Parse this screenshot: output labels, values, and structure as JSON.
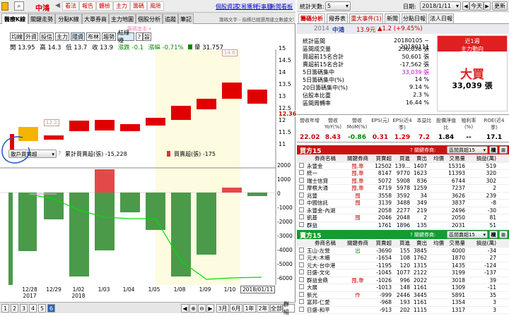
{
  "toolbar": {
    "stock": "中鴻",
    "btns": [
      "看法",
      "報告",
      "體檢",
      "主力",
      "籌碼",
      "風險"
    ],
    "right_links": [
      "個股資訊",
      "交易獲利",
      "行事曆",
      "新聞看板"
    ]
  },
  "chart_tabs": [
    "醫療K線",
    "關鍵走勢",
    "分點K線",
    "大單券商",
    "主力地圖",
    "個股分析",
    "追蹤",
    "筆記"
  ],
  "note": "籌碼文字 - 指標已經選用建立數據文字",
  "watermark": "籌碼查本→",
  "chip_tabs": [
    "均線",
    "外資",
    "投信",
    "主力",
    "隱資",
    "布林",
    "趨勢",
    "紅綠燈",
    "?",
    "設"
  ],
  "ohlc": {
    "open": "開 13.95",
    "high": "高 14.3",
    "low": "低 13.7",
    "close": "收 13.9",
    "chg_label": "漲跌",
    "chg": "-0.1",
    "pct_label": "漲幅",
    "pct": "-0.71%",
    "vol_label": "量",
    "vol": "31,757"
  },
  "price_axis": [
    "15",
    "14.5",
    "14",
    "13.5",
    "13",
    "12.5",
    "12",
    "11.5",
    "11"
  ],
  "price_cur": "12.36",
  "annot_high": "14.6",
  "annot_low": "12.2",
  "vol_select": "散戶買賣超",
  "vol_legend1": "累計買賣超(張) -15,228",
  "vol_legend2": "買賣超(張) -175",
  "vol_axis": [
    "2000",
    "1000",
    "0",
    "-1000",
    "-2000",
    "-3000",
    "-4000",
    "-5000",
    "-6000"
  ],
  "dates": [
    {
      "d": "12/28",
      "y": "2017"
    },
    {
      "d": "12/29",
      "y": ""
    },
    {
      "d": "1/02",
      "y": "2018"
    },
    {
      "d": "1/03",
      "y": ""
    },
    {
      "d": "1/04",
      "y": ""
    },
    {
      "d": "1/05",
      "y": ""
    },
    {
      "d": "1/08",
      "y": ""
    },
    {
      "d": "1/09",
      "y": ""
    },
    {
      "d": "1/10",
      "y": ""
    }
  ],
  "date_label": "2018/01/11",
  "pages": [
    "1",
    "2",
    "3",
    "4",
    "5",
    "6"
  ],
  "ranges": [
    "3月",
    "6月",
    "1年",
    "2年",
    "全部",
    "群組"
  ],
  "right": {
    "top": {
      "label": "統計天數:",
      "days": "5",
      "date_label": "日期:",
      "date": "2018/1/11",
      "today": "今天",
      "refresh": "更新"
    },
    "tabs": [
      "籌碼分析",
      "撥券表",
      "重大事件(1)",
      "新聞",
      "分點日報",
      "法人日報"
    ],
    "stock_line": {
      "year": "2014",
      "name": "中鴻",
      "price": "13.9元",
      "chg": "▲1.2 (+9.45%)"
    },
    "stats": [
      [
        "統計區間",
        "20180105 ~ 20180111"
      ],
      [
        "區間成交量",
        "236,036 張"
      ],
      [
        "買超前15名合計",
        "50,601 張"
      ],
      [
        "賣超前15名合計",
        "-17,562 張"
      ],
      [
        "5日籌碼集中",
        "33,039 張"
      ],
      [
        "5日籌碼集中(%)",
        "14 %"
      ],
      [
        "20日籌碼集中(%)",
        "9.14 %"
      ],
      [
        "佔股本比重",
        "2.3 %"
      ],
      [
        "區間周轉率",
        "16.44 %"
      ]
    ],
    "box": {
      "t1": "近1週",
      "t2": "主力動向",
      "big": "大買",
      "val": "33,039 張"
    },
    "fin_headers": [
      "營收年增",
      "營收YoY(%)",
      "營收MoM(%)",
      "EPS(元)",
      "EPS(近4季)",
      "本益比",
      "股價淨值比",
      "殖利率(%)",
      "ROE(近4季)"
    ],
    "fin_values": [
      "22.02",
      "8.43",
      "-0.86",
      "0.31",
      "1.29",
      "7.2",
      "1.84",
      "--",
      "17.1"
    ],
    "buy": {
      "title": "買方15",
      "hint": "?  關鍵券商:",
      "select": "區間買超15",
      "hdr": [
        "券商名稱",
        "關鍵券商",
        "買賣超",
        "買進",
        "賣出",
        "均價",
        "交易量",
        "損益(萬)"
      ],
      "rows": [
        [
          "永豐金",
          "囤,靠",
          "12502",
          "139...",
          "1407",
          "",
          "15316",
          "519"
        ],
        [
          "統一",
          "囤,靠",
          "8147",
          "9770",
          "1623",
          "",
          "11393",
          "320"
        ],
        [
          "瑞士信貸",
          "囤,靠",
          "5072",
          "5908",
          "836",
          "",
          "6744",
          "302"
        ],
        [
          "摩根大通",
          "囤,靠",
          "4719",
          "5978",
          "1259",
          "",
          "7237",
          "2"
        ],
        [
          "兆豐",
          "囤",
          "3558",
          "3592",
          "34",
          "",
          "3626",
          "239"
        ],
        [
          "中國信託",
          "囤",
          "3139",
          "3488",
          "349",
          "",
          "3837",
          "-8"
        ],
        [
          "永豐金-內湖",
          "",
          "2058",
          "2277",
          "219",
          "",
          "2496",
          "-30"
        ],
        [
          "凱基",
          "囤",
          "2046",
          "2048",
          "2",
          "",
          "2050",
          "81"
        ],
        [
          "群益",
          "",
          "1761",
          "1896",
          "135",
          "",
          "2031",
          "51"
        ]
      ]
    },
    "sell": {
      "title": "賣方15",
      "hint": "?  關鍵券商:",
      "select": "區間賣超15",
      "hdr": [
        "券商名稱",
        "關鍵券商",
        "買賣超",
        "買進",
        "賣出",
        "均價",
        "交易量",
        "損益(萬)"
      ],
      "rows": [
        [
          "玉山-左營",
          "出",
          "-3690",
          "155",
          "3845",
          "",
          "4000",
          "-34"
        ],
        [
          "元大-木柵",
          "",
          "-1654",
          "108",
          "1762",
          "",
          "1870",
          "27"
        ],
        [
          "元大-台中港",
          "",
          "-1195",
          "120",
          "1315",
          "",
          "1435",
          "-124"
        ],
        [
          "日盛-文化",
          "",
          "-1045",
          "1077",
          "2122",
          "",
          "3199",
          "-137"
        ],
        [
          "群益金鼎",
          "囤,靠",
          "-1026",
          "996",
          "2022",
          "",
          "3018",
          "39"
        ],
        [
          "大展",
          "",
          "-1013",
          "148",
          "1161",
          "",
          "1309",
          "-11"
        ],
        [
          "新光",
          "作",
          "-999",
          "2446",
          "3445",
          "",
          "5891",
          "35"
        ],
        [
          "富邦-仁愛",
          "",
          "-968",
          "193",
          "1161",
          "",
          "1354",
          "3"
        ],
        [
          "日盛-和平",
          "",
          "-913",
          "202",
          "1115",
          "",
          "1317",
          "3"
        ]
      ]
    }
  }
}
